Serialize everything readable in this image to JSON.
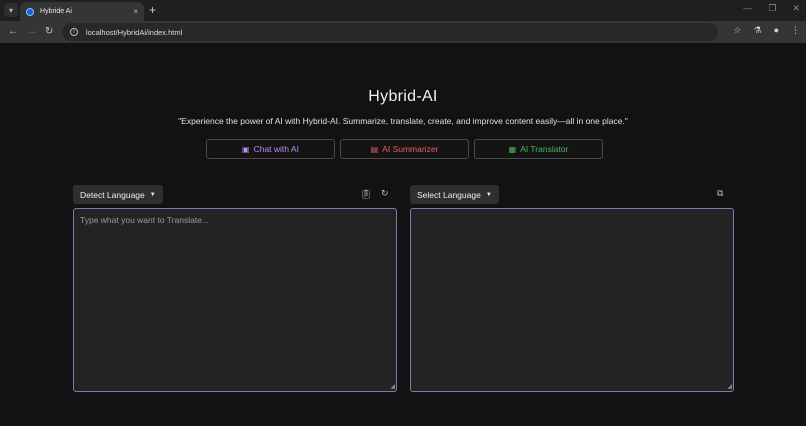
{
  "browser": {
    "tab_title": "Hybride Ai",
    "tab_close": "×",
    "new_tab": "+",
    "url": "localhost/HybridAi/index.html",
    "accent": "#0b6ae0"
  },
  "page": {
    "title": "Hybrid-AI",
    "tagline": "\"Experience the power of AI with Hybrid-AI. Summarize, translate, create, and improve content easily—all in one place.\""
  },
  "modes": [
    {
      "label": "Chat with AI",
      "icon": "robot-icon",
      "color": "#b98cf0"
    },
    {
      "label": "AI Summarizer",
      "icon": "summarizer-icon",
      "color": "#e85c64"
    },
    {
      "label": "AI Translator",
      "icon": "translate-icon",
      "color": "#4cb85a"
    }
  ],
  "source": {
    "language_label": "Detect Language",
    "placeholder": "Type what you want to Translate...",
    "value": ""
  },
  "target": {
    "language_label": "Select Language",
    "value": ""
  }
}
